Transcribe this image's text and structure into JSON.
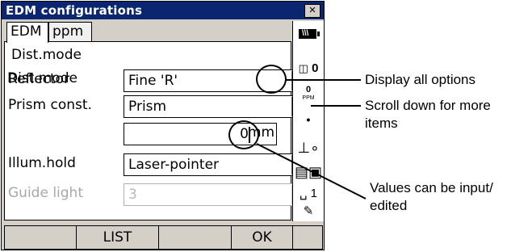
{
  "window": {
    "title": "EDM configurations",
    "close_label": "×"
  },
  "tabs": [
    {
      "label": "EDM",
      "active": true
    },
    {
      "label": "ppm",
      "active": false
    }
  ],
  "form": {
    "dist_mode": {
      "label": "Dist.mode",
      "value": "Fine 'R'"
    },
    "reflector": {
      "label": "Reflector",
      "value": "Prism"
    },
    "prism_const": {
      "label": "Prism const.",
      "value": "0",
      "unit": "mm"
    },
    "illum_hold": {
      "label": "Illum.hold",
      "value": "Laser-pointer"
    },
    "guide_light": {
      "label": "Guide light",
      "value": "3",
      "disabled": true
    }
  },
  "status": {
    "battery_icon": "battery-icon",
    "target": "0",
    "ppm_value": "0",
    "ppm_label": "PPM",
    "tilt_icon": "tilt-icon",
    "mode_icon": "measure-mode-icon",
    "input_mode": "␣ 1",
    "edit_icon": "pencil-icon"
  },
  "softkeys": [
    "",
    "LIST",
    "",
    "OK",
    ""
  ],
  "callouts": [
    {
      "text": "Display all options"
    },
    {
      "text": "Scroll down for more items"
    },
    {
      "text": "Values can be input/ edited"
    }
  ]
}
